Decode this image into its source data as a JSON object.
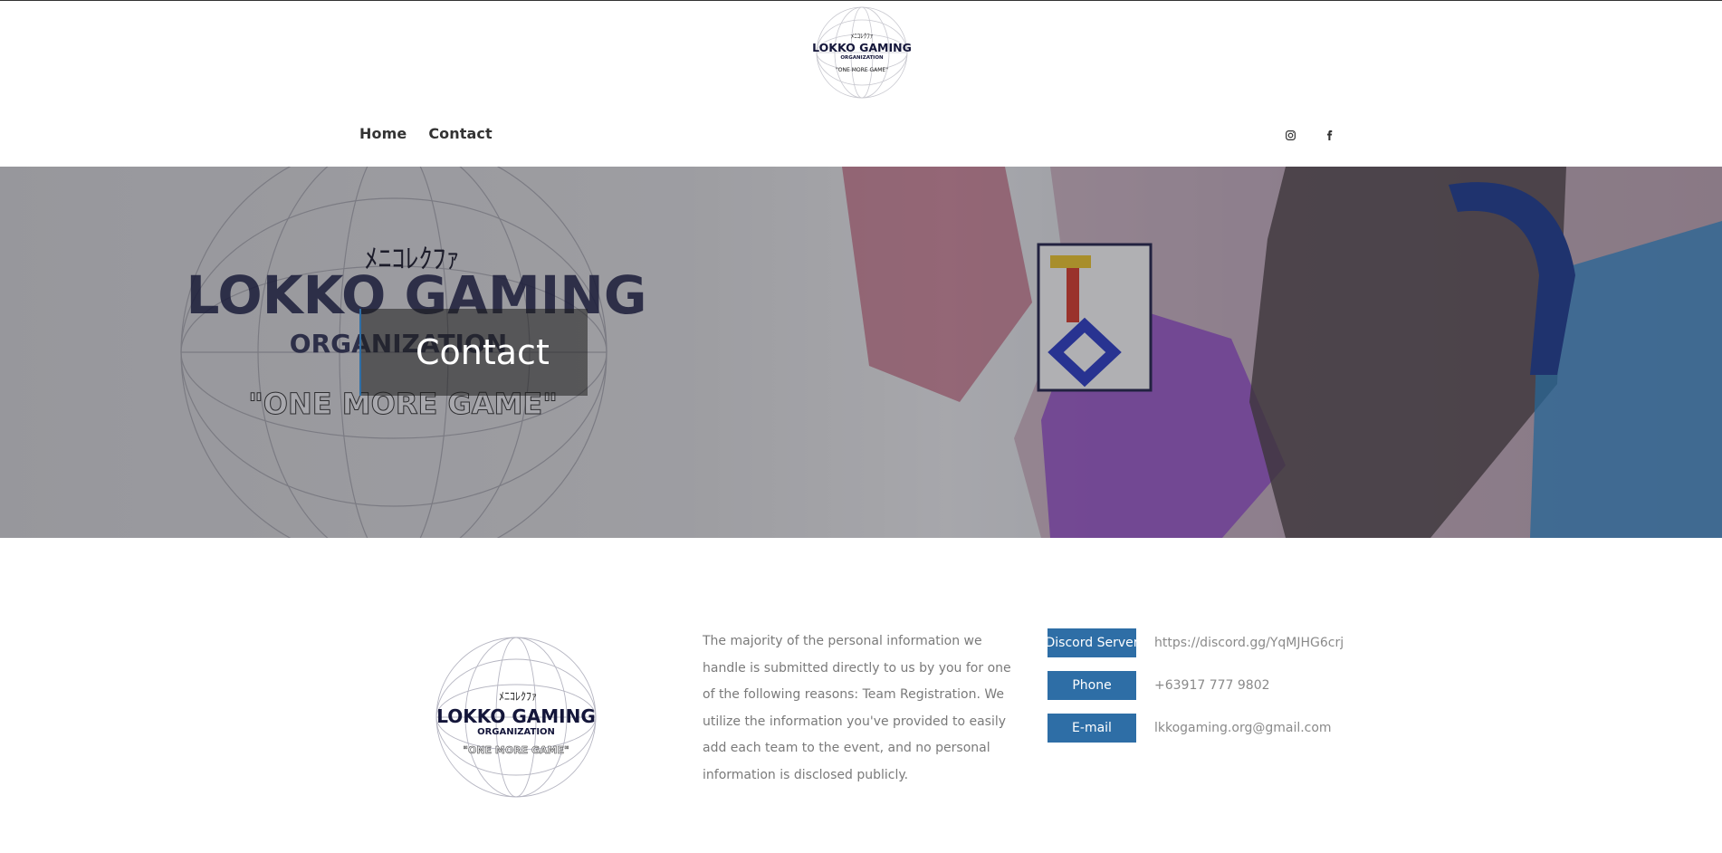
{
  "brand": {
    "logo_text_line1": "LOKKO GAMING",
    "logo_text_line2": "ORGANIZATION",
    "logo_tagline": "\"ONE MORE GAME\""
  },
  "nav": {
    "items": [
      {
        "label": "Home"
      },
      {
        "label": "Contact"
      }
    ]
  },
  "social": {
    "icons": [
      "instagram-icon",
      "facebook-icon"
    ]
  },
  "hero": {
    "title": "Contact",
    "background_text_line1": "LOKKO GAMING",
    "background_text_line2": "ORGANIZATION",
    "background_tagline": "\"ONE MORE GAME\""
  },
  "content": {
    "description": "The majority of the personal information we handle is submitted directly to us by you for one of the following reasons: Team Registration. We utilize the information you've provided to easily add each team to the event, and no personal information is disclosed publicly.",
    "contacts": [
      {
        "label": "Discord Server",
        "value": "https://discord.gg/YqMJHG6crj"
      },
      {
        "label": "Phone",
        "value": "+63917 777 9802"
      },
      {
        "label": "E-mail",
        "value": "lkkogaming.org@gmail.com"
      }
    ]
  },
  "colors": {
    "accent": "#2e6ea6",
    "text": "#333333",
    "muted": "#7a7a7a"
  }
}
